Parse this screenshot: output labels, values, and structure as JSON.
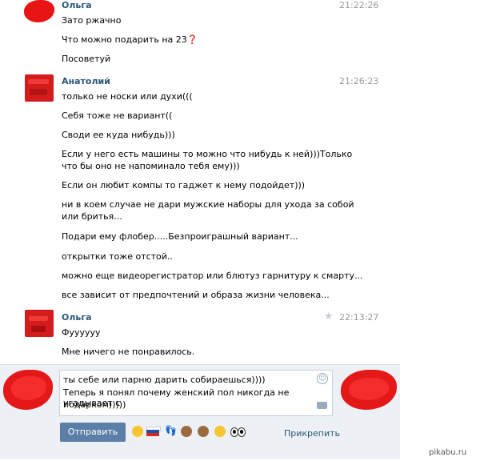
{
  "messages": [
    {
      "author": "Ольга",
      "time": "21:22:26",
      "lines": [
        "Зато ржачно",
        "Что можно подарить на 23❓",
        "Посоветуй"
      ]
    },
    {
      "author": "Анатолий",
      "time": "21:26:23",
      "lines": [
        "только не носки или духи(((",
        "Себя тоже не вариант((",
        "Своди ее куда нибудь)))",
        "Если у него есть машины то можно что нибудь к ней)))Только",
        "что бы оно не напоминало тебя ему)))",
        "Если он любит компы то гаджет к нему подойдет)))",
        "ни в коем случае не дари мужские наборы для ухода за собой",
        "или бритья...",
        "Подари ему флобер.....Безпроиграшный вариант...",
        "открытки тоже отстой..",
        "можно еще видеорегистратор или блютуз гарнитуру к смарту...",
        "все зависит от предпочтений и образа жизни человека..."
      ]
    },
    {
      "author": "Ольга",
      "time": "22:13:27",
      "lines": [
        "Фуууууу",
        "Мне ничего не понравилось."
      ]
    }
  ],
  "composer": {
    "lines": [
      "ты себе или парню дарить собираешься))))",
      "Теперь я понял почему женский пол никогда не угадывает с",
      "подарком)))))"
    ],
    "send_label": "Отправить",
    "attach_label": "Прикрепить"
  },
  "emojis": [
    "smile",
    "russian-flag",
    "footprints",
    "see-no-evil-monkey",
    "hear-no-evil-monkey",
    "smile",
    "eyes"
  ],
  "watermark": "pikabu.ru"
}
